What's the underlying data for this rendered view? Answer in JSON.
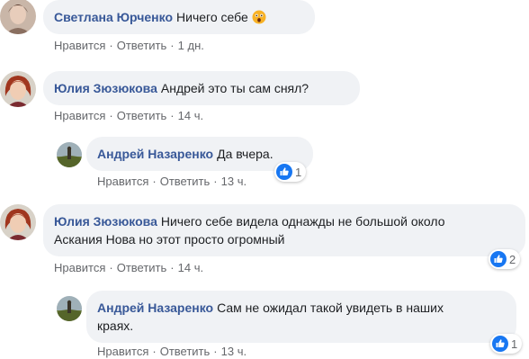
{
  "actions": {
    "like": "Нравится",
    "reply": "Ответить",
    "sep": "·"
  },
  "comments": [
    {
      "author": "Светлана Юрченко",
      "text": "Ничего себе",
      "emoji": "astonished-emoji",
      "time": "1 дн."
    },
    {
      "author": "Юлия Зюзюкова",
      "text": "Андрей это ты сам снял?",
      "time": "14 ч."
    },
    {
      "author": "Андрей Назаренко",
      "text": "Да вчера.",
      "time": "13 ч.",
      "reactions": "1"
    },
    {
      "author": "Юлия Зюзюкова",
      "text_line1": "Ничего себе видела однажды не большой около",
      "text_line2": "Аскания Нова но этот просто огромный",
      "time": "14 ч.",
      "reactions": "2"
    },
    {
      "author": "Андрей Назаренко",
      "text_line1": "Сам не ожидал такой увидеть в наших",
      "text_line2": "краях.",
      "time": "13 ч.",
      "reactions": "1"
    }
  ],
  "colors": {
    "author": "#385898",
    "bubble": "#f0f2f5",
    "meta": "#65676b",
    "like": "#1877f2"
  }
}
